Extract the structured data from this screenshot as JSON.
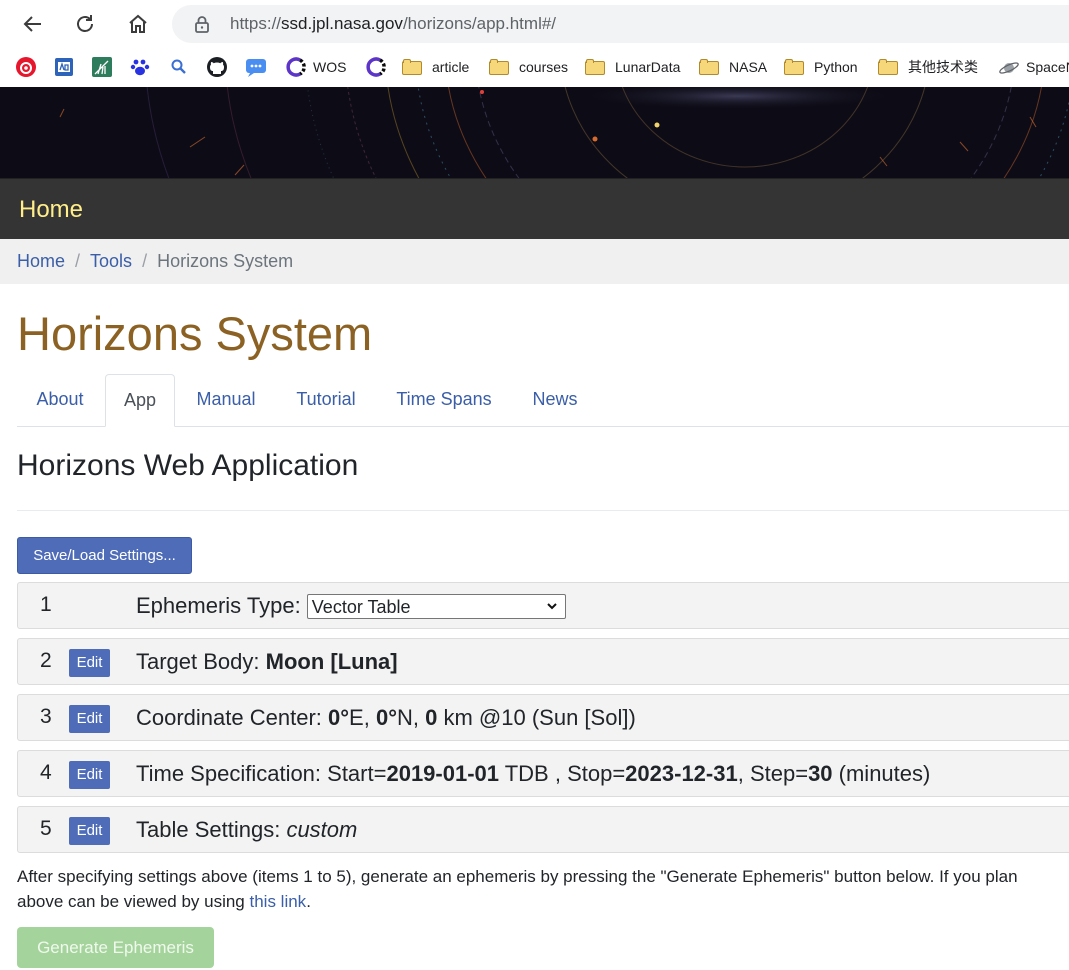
{
  "browser": {
    "url_prefix": "https://",
    "url_host": "ssd.jpl.nasa.gov",
    "url_path": "/horizons/app.html#/",
    "bookmarks": [
      {
        "label": "WOS"
      },
      {
        "label": "article"
      },
      {
        "label": "courses"
      },
      {
        "label": "LunarData"
      },
      {
        "label": "NASA"
      },
      {
        "label": "Python"
      },
      {
        "label": "其他技术类"
      },
      {
        "label": "SpaceN"
      }
    ]
  },
  "nav": {
    "home": "Home"
  },
  "breadcrumb": {
    "home": "Home",
    "tools": "Tools",
    "current": "Horizons System"
  },
  "page_title": "Horizons System",
  "tabs": [
    "About",
    "App",
    "Manual",
    "Tutorial",
    "Time Spans",
    "News"
  ],
  "app_title": "Horizons Web Application",
  "save_load_label": "Save/Load Settings...",
  "edit_label": "Edit",
  "steps": {
    "s1": {
      "num": "1",
      "label": "Ephemeris Type: ",
      "select_value": "Vector Table"
    },
    "s2": {
      "num": "2",
      "label": "Target Body: ",
      "value": "Moon [Luna]"
    },
    "s3": {
      "num": "3",
      "label": "Coordinate Center: ",
      "v1": "0°",
      "t1": "E, ",
      "v2": "0°",
      "t2": "N, ",
      "v3": "0",
      "t3": " km @10 (Sun [Sol])"
    },
    "s4": {
      "num": "4",
      "label": "Time Specification: Start=",
      "start": "2019-01-01",
      "t1": " TDB , Stop=",
      "stop": "2023-12-31",
      "t2": ", Step=",
      "step": "30",
      "t3": " (minutes)"
    },
    "s5": {
      "num": "5",
      "label": "Table Settings: ",
      "value": "custom"
    }
  },
  "note": {
    "line1": "After specifying settings above (items 1 to 5), generate an ephemeris by pressing the \"Generate Ephemeris\" button below. If you plan",
    "line2_a": "above can be viewed by using ",
    "link": "this link",
    "line2_b": "."
  },
  "generate_label": "Generate Ephemeris"
}
